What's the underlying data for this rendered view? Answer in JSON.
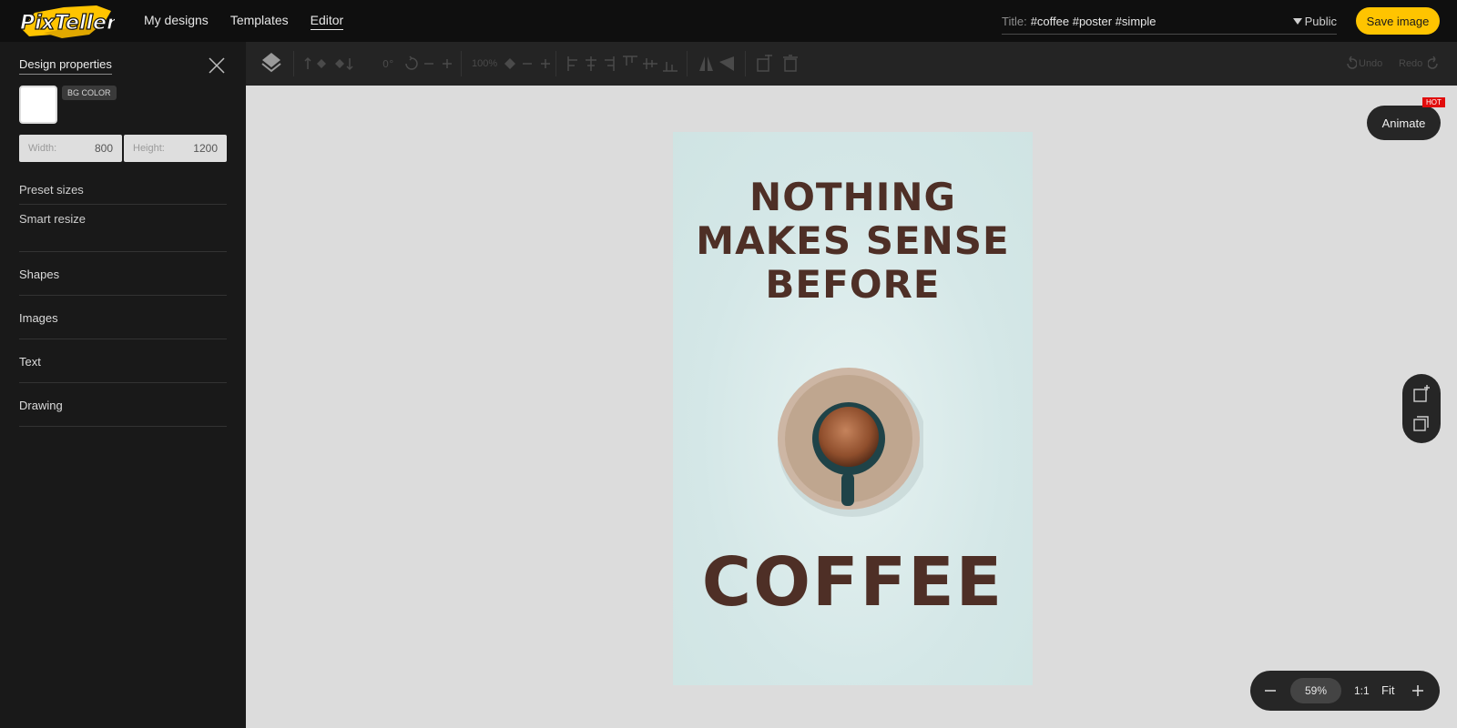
{
  "app": {
    "logo_text": "PixTeller"
  },
  "nav": {
    "items": [
      "My designs",
      "Templates",
      "Editor"
    ],
    "active": "Editor"
  },
  "title": {
    "label": "Title:",
    "value": "#coffee #poster #simple"
  },
  "visibility": "Public",
  "save_label": "Save image",
  "sidebar": {
    "title": "Design properties",
    "bg_label": "BG COLOR",
    "bg_color": "#ffffff",
    "width_label": "Width:",
    "width_value": "800",
    "height_label": "Height:",
    "height_value": "1200",
    "links": [
      "Preset sizes",
      "Smart resize"
    ],
    "sections": [
      "Shapes",
      "Images",
      "Text",
      "Drawing"
    ]
  },
  "toolbar": {
    "opacity": "100%",
    "undo": "Undo",
    "redo": "Redo"
  },
  "poster": {
    "headline": [
      "NOTHING",
      "MAKES SENSE",
      "BEFORE"
    ],
    "footer": "COFFEE",
    "bg_color": "#d4e7e7",
    "text_color": "#4e2f26"
  },
  "animate": {
    "label": "Animate",
    "badge": "HOT"
  },
  "zoom": {
    "value": "59%",
    "one_to_one": "1:1",
    "fit": "Fit"
  },
  "colors": {
    "accent": "#ffc400",
    "topbar": "#0f0f0f",
    "sidebar": "#191919",
    "hot": "#e10c0c"
  }
}
